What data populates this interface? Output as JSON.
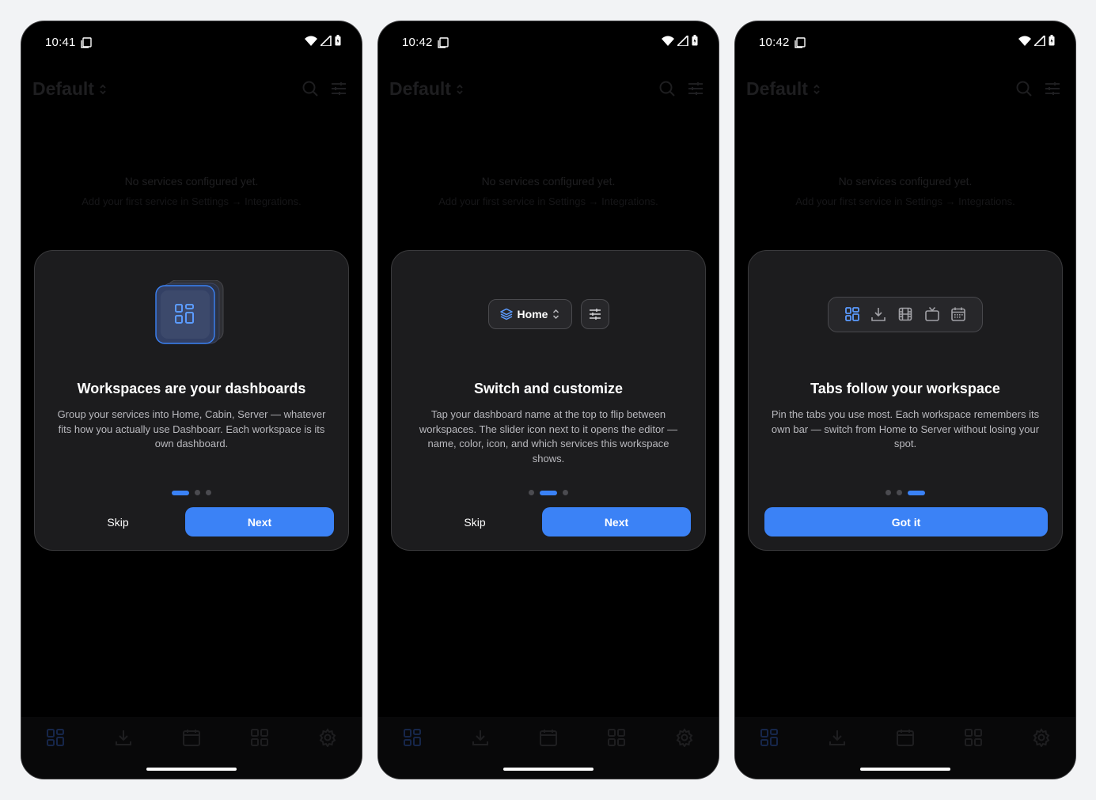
{
  "screens": [
    {
      "time": "10:41",
      "workspace_title": "Default",
      "empty_line1": "No services configured yet.",
      "empty_line2": "Add your first service in Settings → Integrations.",
      "title": "Workspaces are your dashboards",
      "body": "Group your services into Home, Cabin, Server — whatever fits how you actually use Dashboarr. Each workspace is its own dashboard.",
      "skip": "Skip",
      "next": "Next",
      "active_step": 1
    },
    {
      "time": "10:42",
      "workspace_title": "Default",
      "empty_line1": "No services configured yet.",
      "empty_line2": "Add your first service in Settings → Integrations.",
      "pill_label": "Home",
      "title": "Switch and customize",
      "body": "Tap your dashboard name at the top to flip between workspaces. The slider icon next to it opens the editor — name, color, icon, and which services this workspace shows.",
      "skip": "Skip",
      "next": "Next",
      "active_step": 2
    },
    {
      "time": "10:42",
      "workspace_title": "Default",
      "empty_line1": "No services configured yet.",
      "empty_line2": "Add your first service in Settings → Integrations.",
      "title": "Tabs follow your workspace",
      "body": "Pin the tabs you use most. Each workspace remembers its own bar — switch from Home to Server without losing your spot.",
      "got_it": "Got it",
      "active_step": 3
    }
  ],
  "total_steps": 3,
  "colors": {
    "accent": "#3b82f6",
    "card": "#1c1c1e",
    "background": "#000000"
  },
  "bottom_nav_icons": [
    "grid-icon",
    "download-icon",
    "calendar-icon",
    "grid-icon",
    "gear-icon"
  ],
  "tab_preview_icons": [
    "grid-icon",
    "download-icon",
    "film-icon",
    "tv-icon",
    "calendar-icon"
  ]
}
